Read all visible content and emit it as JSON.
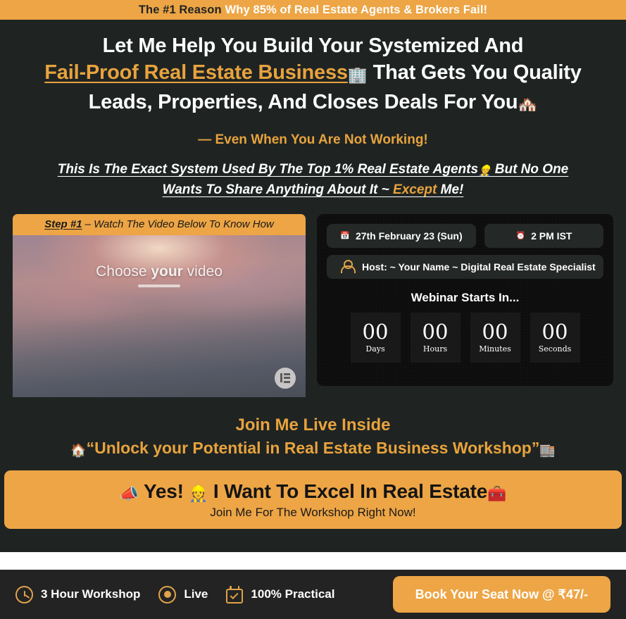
{
  "topbar": {
    "lead": "The #1 Reason",
    "rest": "Why 85% of Real Estate Agents & Brokers Fail!"
  },
  "headline": {
    "line1": "Let Me Help You Build Your Systemized And",
    "accent": "Fail-Proof Real Estate Business",
    "building_emoji": "🏢",
    "line2_rest": "That Gets You Quality",
    "line3": "Leads, Properties, And Closes Deals For You",
    "houses_emoji": "🏘️"
  },
  "subheads": {
    "orange": "— Even When You Are Not Working!",
    "italic_part1": "This Is The Exact System Used By The Top 1% Real Estate Agents",
    "worker_emoji": "👷",
    "italic_part2": "But No One Wants To Share Anything About It ~",
    "except": "Except",
    "italic_end": "Me!"
  },
  "video": {
    "step_label": "Step #1",
    "step_text": "– Watch The Video Below To Know How",
    "caption_pre": "Choose ",
    "caption_bold": "your",
    "caption_post": " video",
    "badge_name": "Elementor"
  },
  "info": {
    "date_emoji": "📅",
    "date": "27th February 23 (Sun)",
    "time_emoji": "⏰",
    "time": "2 PM IST",
    "host": "Host: ~ Your Name ~ Digital Real Estate Specialist",
    "webinar_starts": "Webinar Starts In...",
    "countdown": [
      {
        "value": "00",
        "label": "Days"
      },
      {
        "value": "00",
        "label": "Hours"
      },
      {
        "value": "00",
        "label": "Minutes"
      },
      {
        "value": "00",
        "label": "Seconds"
      }
    ]
  },
  "join": {
    "title": "Join Me Live Inside",
    "house_emoji": "🏠",
    "quote": "“Unlock your Potential in Real Estate Business Workshop”",
    "building_emoji": "🏬"
  },
  "cta": {
    "megaphone_emoji": "📣",
    "yes": "Yes!",
    "worker_emoji": "👷",
    "main": "I Want To Excel In Real Estate",
    "toolbox_emoji": "🧰",
    "sub": "Join Me For The Workshop Right Now!"
  },
  "footer": {
    "features": [
      {
        "icon": "clock-icon",
        "label": "3 Hour Workshop"
      },
      {
        "icon": "live-dot-icon",
        "label": "Live"
      },
      {
        "icon": "calendar-check-icon",
        "label": "100% Practical"
      }
    ],
    "book_button": "Book Your Seat Now @ ₹47/-"
  },
  "colors": {
    "accent": "#eda545",
    "accent_text": "#e8a33d",
    "background": "#1f2423",
    "panel": "#0d0d0d",
    "footer_bg": "#232323"
  }
}
